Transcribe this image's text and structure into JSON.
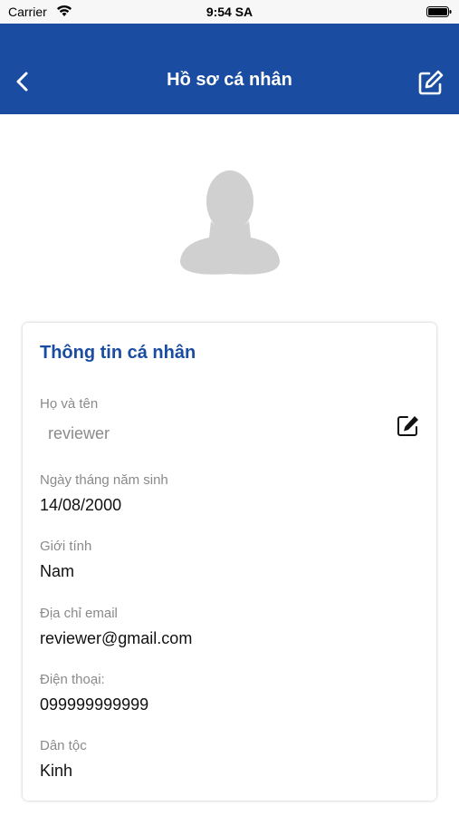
{
  "status_bar": {
    "carrier": "Carrier",
    "time": "9:54 SA"
  },
  "header": {
    "title": "Hồ sơ cá nhân",
    "background": "#1a4da1"
  },
  "profile_card": {
    "title": "Thông tin cá nhân",
    "fields": [
      {
        "label": "Họ và tên",
        "value": "reviewer"
      },
      {
        "label": "Ngày tháng năm sinh",
        "value": "14/08/2000"
      },
      {
        "label": "Giới tính",
        "value": "Nam"
      },
      {
        "label": "Địa chỉ email",
        "value": "reviewer@gmail.com"
      },
      {
        "label": "Điện thoại:",
        "value": "099999999999"
      },
      {
        "label": "Dân tộc",
        "value": "Kinh"
      }
    ]
  },
  "icons": {
    "back": "chevron-left-icon",
    "edit_profile": "edit-icon",
    "edit_name": "edit-icon",
    "avatar": "user-silhouette-icon"
  }
}
